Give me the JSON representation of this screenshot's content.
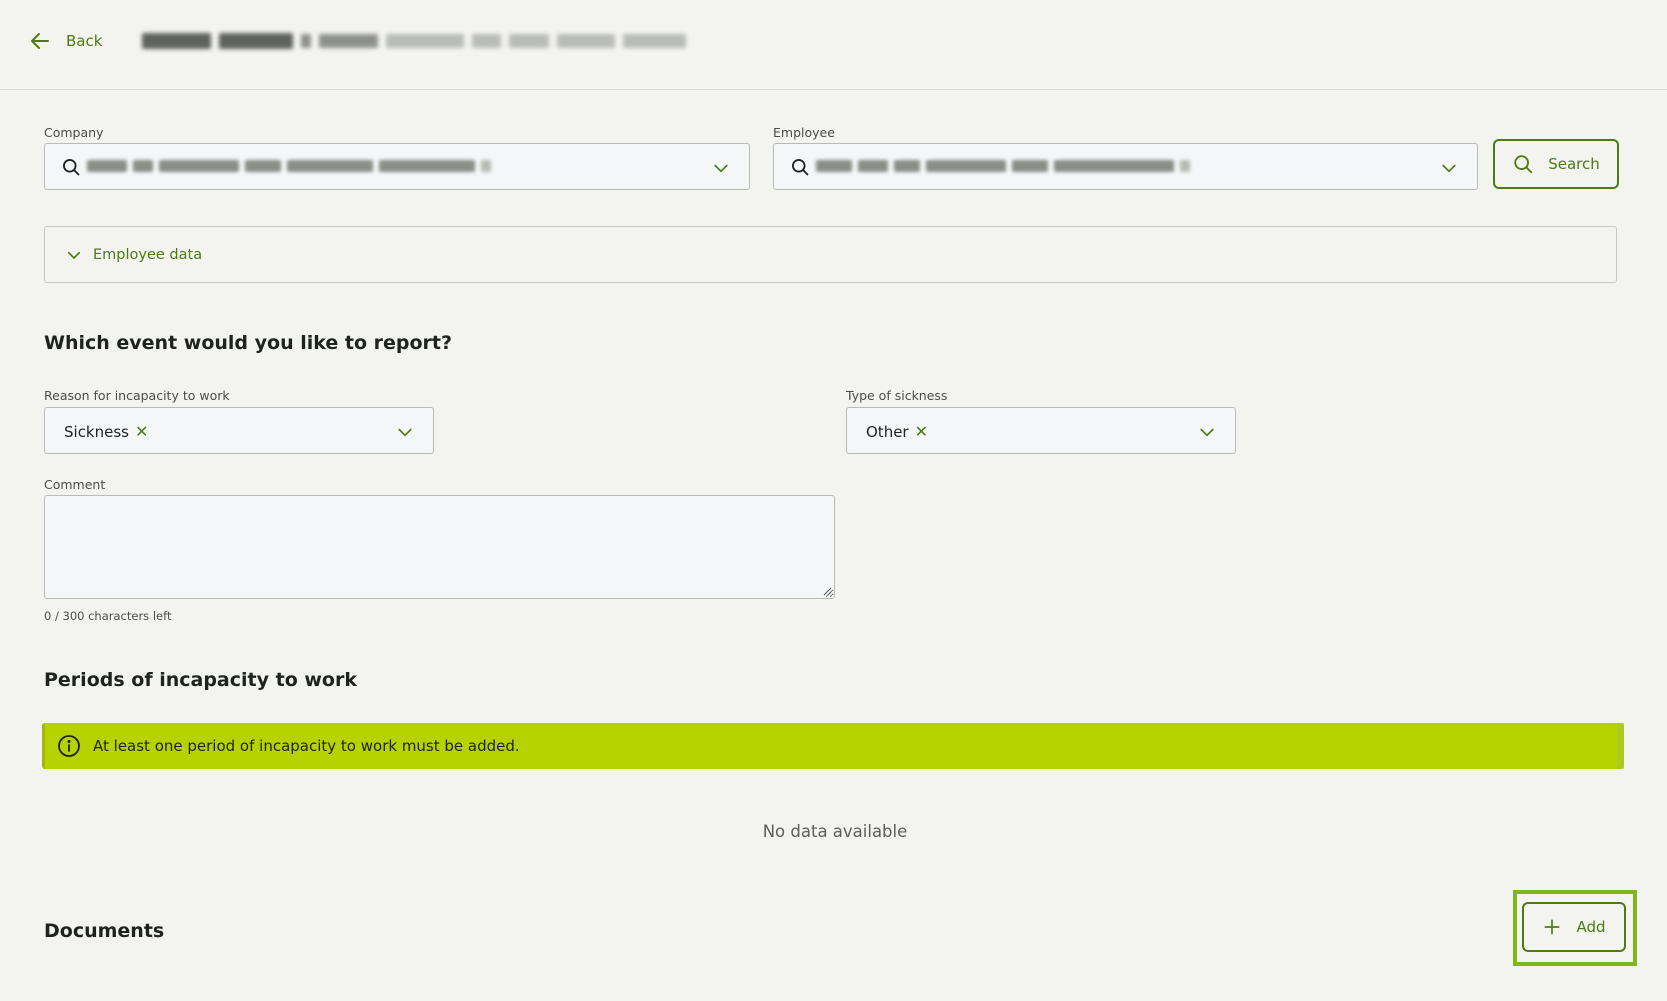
{
  "header": {
    "back_label": "Back",
    "back_icon": "arrow-left-icon"
  },
  "selection": {
    "company_label": "Company",
    "employee_label": "Employee",
    "search_button_label": "Search"
  },
  "employee_data": {
    "label": "Employee data"
  },
  "event": {
    "heading": "Which event would you like to report?",
    "reason_label": "Reason for incapacity to work",
    "reason_value": "Sickness",
    "sickness_type_label": "Type of sickness",
    "sickness_type_value": "Other",
    "comment_label": "Comment",
    "char_count": "0 / 300 characters left"
  },
  "periods": {
    "heading": "Periods of incapacity to work",
    "alert_message": "At least one period of incapacity to work must be added.",
    "empty_text": "No data available"
  },
  "documents": {
    "heading": "Documents",
    "add_label": "Add"
  },
  "colors": {
    "accent": "#4e7a12",
    "alert_background": "#b6d300",
    "highlight": "#7fb81c",
    "background": "#f3f3ef"
  }
}
